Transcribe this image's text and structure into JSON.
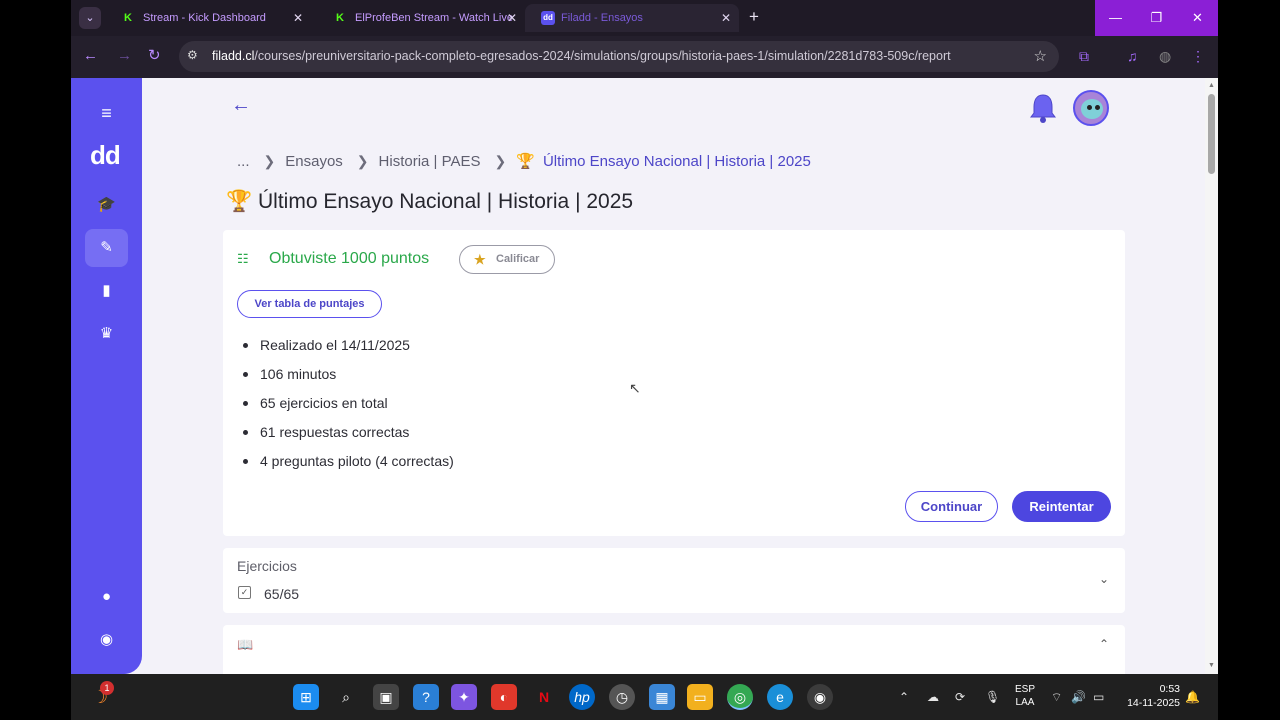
{
  "browser": {
    "tabs": [
      {
        "title": "Stream - Kick Dashboard",
        "favicon": "K"
      },
      {
        "title": "ElProfeBen Stream - Watch Live",
        "favicon": "K"
      },
      {
        "title": "Filadd - Ensayos",
        "favicon": "dd"
      }
    ],
    "url_host": "filadd.cl",
    "url_path": "/courses/preuniversitario-pack-completo-egresados-2024/simulations/groups/historia-paes-1/simulation/2281d783-509c/report"
  },
  "app": {
    "logo": "dd",
    "accent": "#5b51ee",
    "breadcrumb": {
      "ellipsis": "...",
      "items": [
        "Ensayos",
        "Historia | PAES"
      ],
      "current": "Último Ensayo Nacional | Historia | 2025"
    },
    "page_title": "Último Ensayo Nacional | Historia | 2025",
    "result": {
      "score_text": "Obtuviste 1000 puntos",
      "rate_label": "Calificar",
      "table_label": "Ver tabla de puntajes",
      "facts": [
        "Realizado el 14/11/2025",
        "106 minutos",
        "65 ejercicios en total",
        "61 respuestas correctas",
        "4 preguntas piloto (4 correctas)"
      ],
      "continue_label": "Continuar",
      "retry_label": "Reintentar"
    },
    "exercises": {
      "label": "Ejercicios",
      "count": "65/65"
    }
  },
  "taskbar": {
    "lang": "ESP",
    "lang_sub": "LAA",
    "time": "0:53",
    "date": "14-11-2025",
    "badge": "1"
  }
}
